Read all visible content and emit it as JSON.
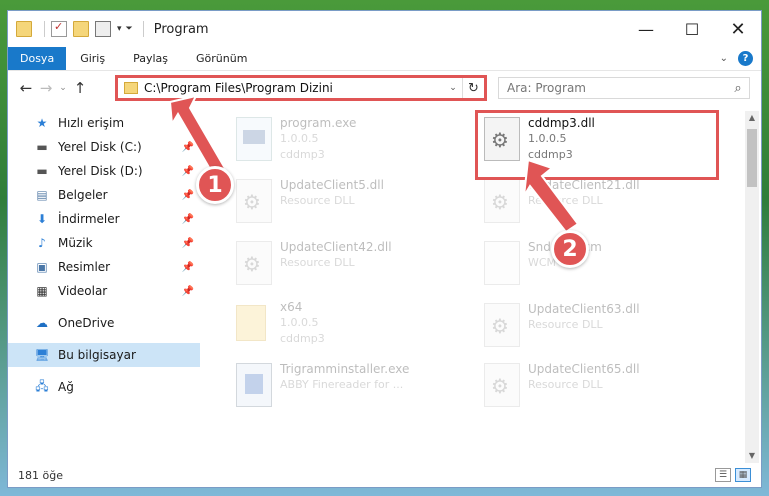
{
  "window": {
    "title": "Program",
    "controls": {
      "minimize": "—",
      "maximize": "☐",
      "close": "✕"
    }
  },
  "ribbon": {
    "tabs": [
      "Dosya",
      "Giriş",
      "Paylaş",
      "Görünüm"
    ],
    "help": "?"
  },
  "nav": {
    "address": "C:\\Program Files\\Program Dizini",
    "search_placeholder": "Ara: Program"
  },
  "sidebar": {
    "items": [
      {
        "label": "Hızlı erişim",
        "icon": "star-icon"
      },
      {
        "label": "Yerel Disk (C:)",
        "icon": "drive-icon",
        "pinned": true
      },
      {
        "label": "Yerel Disk (D:)",
        "icon": "drive-icon",
        "pinned": true
      },
      {
        "label": "Belgeler",
        "icon": "documents-icon",
        "pinned": true
      },
      {
        "label": "İndirmeler",
        "icon": "downloads-icon",
        "pinned": true
      },
      {
        "label": "Müzik",
        "icon": "music-icon",
        "pinned": true
      },
      {
        "label": "Resimler",
        "icon": "pictures-icon",
        "pinned": true
      },
      {
        "label": "Videolar",
        "icon": "videos-icon",
        "pinned": true
      },
      {
        "label": "OneDrive",
        "icon": "cloud-icon"
      },
      {
        "label": "Bu bilgisayar",
        "icon": "computer-icon",
        "selected": true
      },
      {
        "label": "Ağ",
        "icon": "network-icon"
      }
    ]
  },
  "files": [
    {
      "name": "program.exe",
      "line2": "1.0.0.5",
      "line3": "cddmp3",
      "type": "exe",
      "faded": true
    },
    {
      "name": "cddmp3.dll",
      "line2": "1.0.0.5",
      "line3": "cddmp3",
      "type": "dll",
      "faded": false
    },
    {
      "name": "UpdateClient5.dll",
      "line2": "Resource DLL",
      "type": "dll",
      "faded": true
    },
    {
      "name": "UpdateClient21.dll",
      "line2": "Resource DLL",
      "type": "dll",
      "faded": true
    },
    {
      "name": "UpdateClient42.dll",
      "line2": "Resource DLL",
      "type": "dll",
      "faded": true
    },
    {
      "name": "Snd...0.wcm",
      "line2": "WCM",
      "type": "doc",
      "faded": true
    },
    {
      "name": "x64",
      "line2": "1.0.0.5",
      "line3": "cddmp3",
      "type": "folder",
      "faded": true
    },
    {
      "name": "UpdateClient63.dll",
      "line2": "Resource DLL",
      "type": "dll",
      "faded": true
    },
    {
      "name": "Trigramminstaller.exe",
      "line2": "ABBY Finereader for ...",
      "type": "setup",
      "faded": true
    },
    {
      "name": "UpdateClient65.dll",
      "line2": "Resource DLL",
      "type": "dll",
      "faded": true
    }
  ],
  "status": {
    "count": "181 öğe"
  },
  "callouts": [
    "1",
    "2"
  ],
  "colors": {
    "accent": "#1979ca",
    "callout": "#e05555",
    "selection": "#cce4f7"
  }
}
